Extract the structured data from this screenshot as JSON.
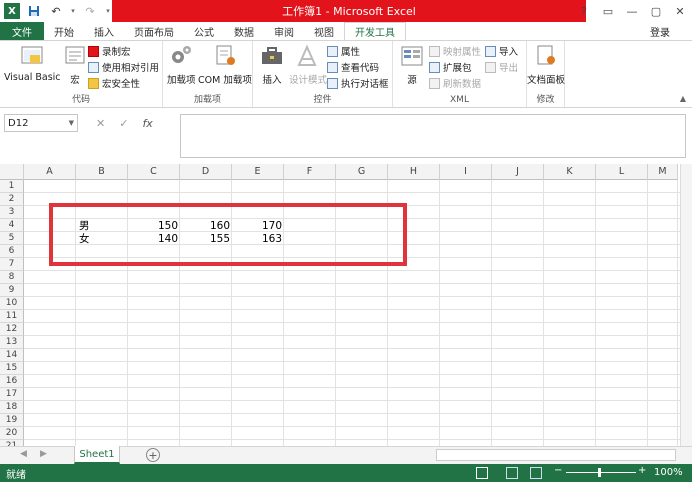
{
  "titlebar": {
    "title": "工作簿1 - Microsoft Excel",
    "controls": [
      "?",
      "▭",
      "—",
      "▢",
      "✕"
    ]
  },
  "tabs": {
    "file": "文件",
    "items": [
      "开始",
      "插入",
      "页面布局",
      "公式",
      "数据",
      "审阅",
      "视图"
    ],
    "active": "开发工具",
    "login": "登录"
  },
  "ribbon": {
    "code": {
      "label": "代码",
      "visual_basic": "Visual Basic",
      "macro": "宏",
      "record_macro": "录制宏",
      "relative_ref": "使用相对引用",
      "macro_security": "宏安全性"
    },
    "addins": {
      "label": "加载项",
      "addins": "加载项",
      "com_addins": "COM 加载项"
    },
    "controls": {
      "label": "控件",
      "insert": "插入",
      "design_mode": "设计模式",
      "properties": "属性",
      "view_code": "查看代码",
      "run_dialog": "执行对话框"
    },
    "xml": {
      "label": "XML",
      "source": "源",
      "map_properties": "映射属性",
      "expansion_packs": "扩展包",
      "refresh_data": "刷新数据",
      "import": "导入",
      "export": "导出"
    },
    "modify": {
      "label": "修改",
      "doc_panel": "文档面板"
    }
  },
  "formula_bar": {
    "name_box": "D12",
    "cancel": "✕",
    "enter": "✓",
    "fx": "fx",
    "formula": ""
  },
  "grid": {
    "columns": [
      "A",
      "B",
      "C",
      "D",
      "E",
      "F",
      "G",
      "H",
      "I",
      "J",
      "K",
      "L",
      "M"
    ],
    "rows": [
      "1",
      "2",
      "3",
      "4",
      "5",
      "6",
      "7",
      "8",
      "9",
      "10",
      "11",
      "12",
      "13",
      "14",
      "15",
      "16",
      "17",
      "18",
      "19",
      "20",
      "21"
    ],
    "data": {
      "B4": "男",
      "C4": "150",
      "D4": "160",
      "E4": "170",
      "B5": "女",
      "C5": "140",
      "D5": "155",
      "E5": "163"
    }
  },
  "sheets": {
    "active": "Sheet1",
    "add": "+"
  },
  "status": {
    "ready": "就绪",
    "zoom": "100%"
  }
}
